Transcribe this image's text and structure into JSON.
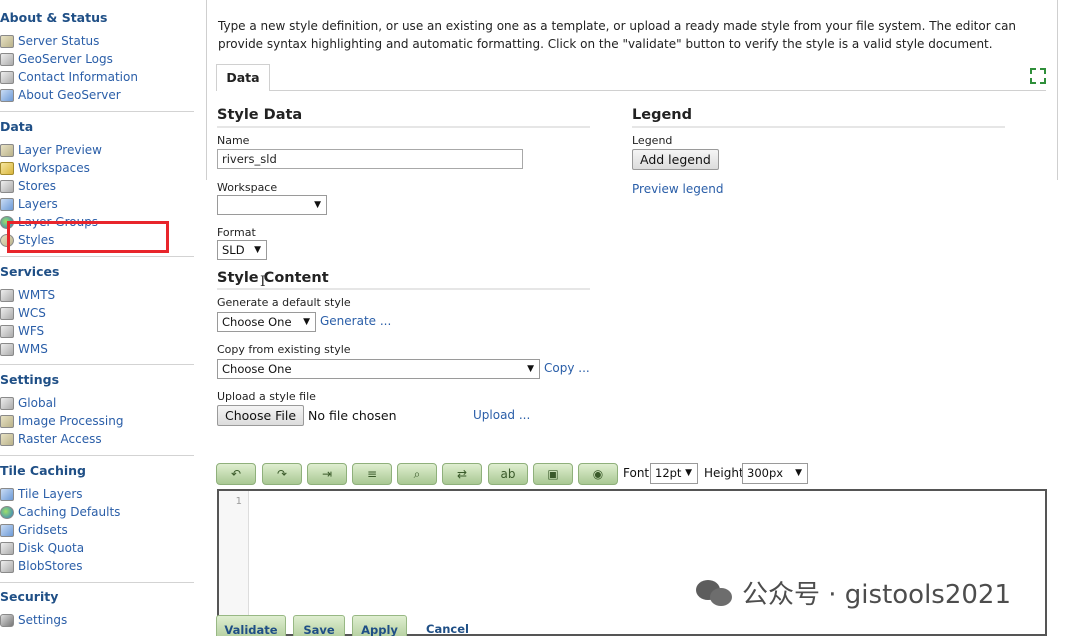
{
  "sidebar": {
    "sections": [
      {
        "title": "About & Status",
        "items": [
          "Server Status",
          "GeoServer Logs",
          "Contact Information",
          "About GeoServer"
        ]
      },
      {
        "title": "Data",
        "items": [
          "Layer Preview",
          "Workspaces",
          "Stores",
          "Layers",
          "Layer Groups",
          "Styles"
        ]
      },
      {
        "title": "Services",
        "items": [
          "WMTS",
          "WCS",
          "WFS",
          "WMS"
        ]
      },
      {
        "title": "Settings",
        "items": [
          "Global",
          "Image Processing",
          "Raster Access"
        ]
      },
      {
        "title": "Tile Caching",
        "items": [
          "Tile Layers",
          "Caching Defaults",
          "Gridsets",
          "Disk Quota",
          "BlobStores"
        ]
      },
      {
        "title": "Security",
        "items": [
          "Settings"
        ]
      }
    ],
    "highlight_color": "#e8252b"
  },
  "intro": "Type a new style definition, or use an existing one as a template, or upload a ready made style from your file system. The editor can provide syntax highlighting and automatic formatting. Click on the \"validate\" button to verify the style is a valid style document.",
  "tab": {
    "label": "Data"
  },
  "style_data": {
    "heading": "Style Data",
    "name_label": "Name",
    "name_value": "rivers_sld",
    "workspace_label": "Workspace",
    "workspace_value": "",
    "format_label": "Format",
    "format_value": "SLD"
  },
  "legend": {
    "heading": "Legend",
    "label": "Legend",
    "add_button": "Add legend",
    "preview_link": "Preview legend"
  },
  "style_content": {
    "heading": "Style Content",
    "generate_label": "Generate a default style",
    "generate_select": "Choose One",
    "generate_link": "Generate ...",
    "copy_label": "Copy from existing style",
    "copy_select": "Choose One",
    "copy_link": "Copy ...",
    "upload_label": "Upload a style file",
    "choose_file": "Choose File",
    "no_file": "No file chosen",
    "upload_link": "Upload ..."
  },
  "toolbar": {
    "icons": [
      "undo-icon",
      "redo-icon",
      "goto-line-icon",
      "reformat-icon",
      "search-icon",
      "replace-icon",
      "format-icon",
      "image-icon",
      "color-picker-icon"
    ],
    "font_label": "Font",
    "font_value": "12pt",
    "height_label": "Height",
    "height_value": "300px"
  },
  "editor": {
    "line_number": "1"
  },
  "actions": {
    "validate": "Validate",
    "save": "Save",
    "apply": "Apply",
    "cancel": "Cancel"
  },
  "watermark": "公众号 · gistools2021"
}
